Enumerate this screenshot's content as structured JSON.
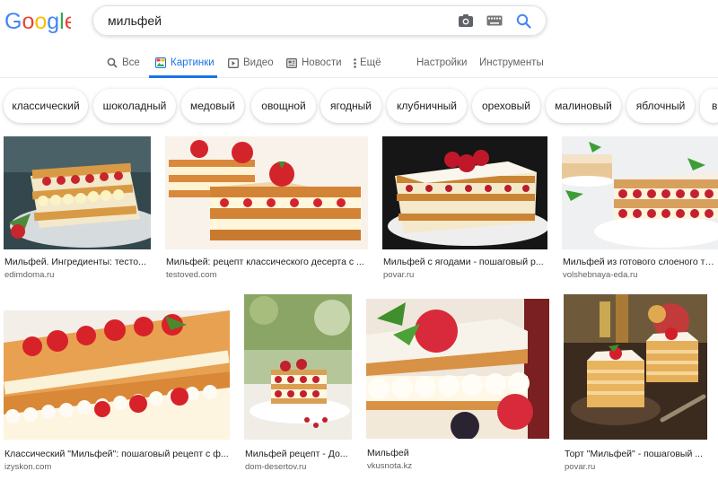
{
  "logo_text": "Google",
  "search": {
    "query": "мильфей"
  },
  "tabs": [
    {
      "label": "Все",
      "icon": "search-icon"
    },
    {
      "label": "Картинки",
      "icon": "image-icon"
    },
    {
      "label": "Видео",
      "icon": "video-icon"
    },
    {
      "label": "Новости",
      "icon": "news-icon"
    },
    {
      "label": "Ещё",
      "icon": "more-vert-icon"
    },
    {
      "label": "Настройки"
    },
    {
      "label": "Инструменты"
    }
  ],
  "chips": [
    "классический",
    "шоколадный",
    "медовый",
    "овощной",
    "ягодный",
    "клубничный",
    "ореховый",
    "малиновый",
    "яблочный",
    "в"
  ],
  "results": [
    {
      "caption": "Мильфей. Ингредиенты: тесто...",
      "source": "edimdoma.ru"
    },
    {
      "caption": "Мильфей: рецепт классического десерта с ...",
      "source": "testoved.com"
    },
    {
      "caption": "Мильфей с ягодами - пошаговый р...",
      "source": "povar.ru"
    },
    {
      "caption": "Мильфей из готового слоеного тесто...",
      "source": "volshebnaya-eda.ru"
    },
    {
      "caption": "Классический \"Мильфей\": пошаговый рецепт с ф...",
      "source": "izyskon.com"
    },
    {
      "caption": "Мильфей рецепт - До...",
      "source": "dom-desertov.ru"
    },
    {
      "caption": "Мильфей",
      "source": "vkusnota.kz"
    },
    {
      "caption": "Торт \"Мильфей\" - пошаговый ...",
      "source": "povar.ru"
    }
  ],
  "colors": {
    "google_blue": "#4285F4",
    "google_red": "#EA4335",
    "google_yellow": "#FBBC05",
    "google_green": "#34A853",
    "accent": "#1a73e8",
    "pastry": "#e0a24a",
    "cream": "#fff6da",
    "strawberry": "#d8262b"
  }
}
